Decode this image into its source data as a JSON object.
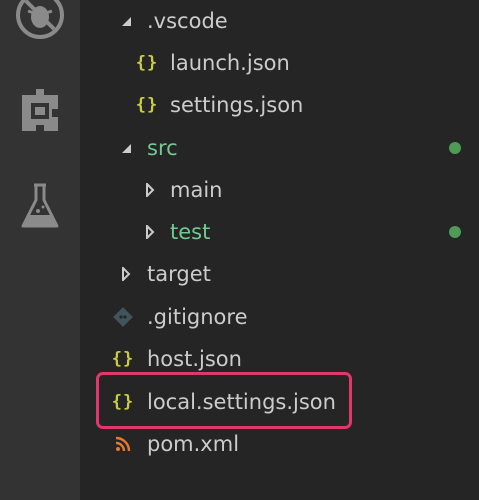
{
  "activity_bar": {
    "icons": [
      "debug-icon",
      "extensions-icon",
      "test-flask-icon"
    ]
  },
  "tree": {
    "vscode_folder": ".vscode",
    "launch_json": "launch.json",
    "settings_json": "settings.json",
    "src_folder": "src",
    "main_folder": "main",
    "test_folder": "test",
    "target_folder": "target",
    "gitignore": ".gitignore",
    "host_json": "host.json",
    "local_settings_json": "local.settings.json",
    "pom_xml": "pom.xml",
    "json_icon_glyph": "{}"
  },
  "colors": {
    "modified_dot": "#4d9b55",
    "modified_text": "#73c991",
    "highlight_border": "#e0386b",
    "json_icon": "#cbcb41",
    "rss_icon": "#e37933",
    "git_icon": "#41535b"
  }
}
